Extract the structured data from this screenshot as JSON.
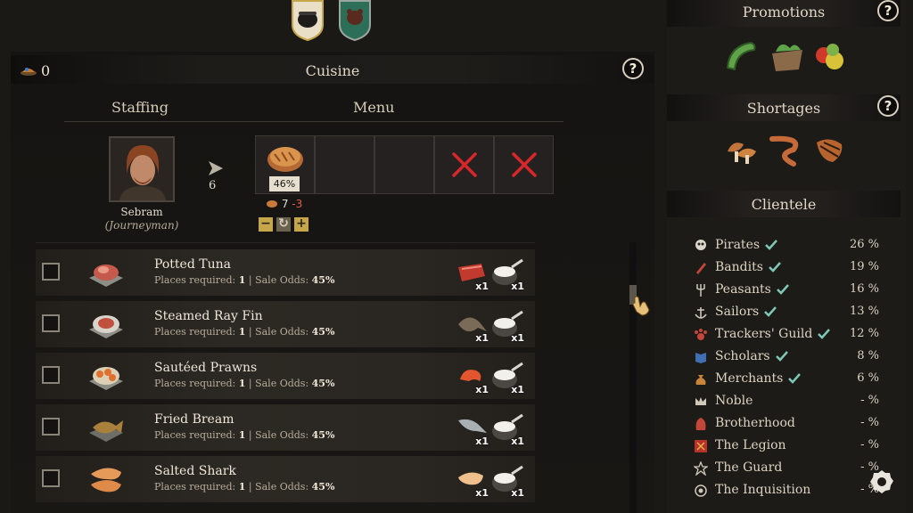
{
  "tabs": [
    {
      "name": "cuisine-tab",
      "icon": "cooking-pot-icon",
      "active": true
    },
    {
      "name": "bear-tab",
      "icon": "bear-banner-icon",
      "active": false
    }
  ],
  "header": {
    "money_icon": "coin-pile-icon",
    "money_value": "0",
    "title": "Cuisine",
    "help": "?"
  },
  "sections": {
    "staffing": "Staffing",
    "menu": "Menu"
  },
  "worker": {
    "name": "Sebram",
    "rank": "(Journeyman)",
    "places": "6"
  },
  "menu_slots": {
    "filled": {
      "dish_icon": "bread-loaf-icon",
      "odds": "46%",
      "stat": "7",
      "stat_delta": "-3"
    },
    "locked_icon": "red-x-icon",
    "controls": {
      "minus": "−",
      "reset": "↻",
      "plus": "+"
    }
  },
  "recipes": [
    {
      "name": "Potted Tuna",
      "places_label": "Places required:",
      "places": "1",
      "odds_label": "Sale Odds:",
      "odds": "45%",
      "ingredients": [
        {
          "icon": "tuna-fillet-icon",
          "qty": "x1"
        },
        {
          "icon": "salt-bowl-icon",
          "qty": "x1"
        }
      ]
    },
    {
      "name": "Steamed Ray Fin",
      "places_label": "Places required:",
      "places": "1",
      "odds_label": "Sale Odds:",
      "odds": "45%",
      "ingredients": [
        {
          "icon": "ray-fish-icon",
          "qty": "x1"
        },
        {
          "icon": "salt-bowl-icon",
          "qty": "x1"
        }
      ]
    },
    {
      "name": "Sautéed Prawns",
      "places_label": "Places required:",
      "places": "1",
      "odds_label": "Sale Odds:",
      "odds": "45%",
      "ingredients": [
        {
          "icon": "prawn-icon",
          "qty": "x1"
        },
        {
          "icon": "salt-bowl-icon",
          "qty": "x1"
        }
      ]
    },
    {
      "name": "Fried Bream",
      "places_label": "Places required:",
      "places": "1",
      "odds_label": "Sale Odds:",
      "odds": "45%",
      "ingredients": [
        {
          "icon": "bream-fish-icon",
          "qty": "x1"
        },
        {
          "icon": "salt-bowl-icon",
          "qty": "x1"
        }
      ]
    },
    {
      "name": "Salted Shark",
      "places_label": "Places required:",
      "places": "1",
      "odds_label": "Sale Odds:",
      "odds": "45%",
      "ingredients": [
        {
          "icon": "shark-meat-icon",
          "qty": "x1"
        },
        {
          "icon": "salt-bowl-icon",
          "qty": "x1"
        }
      ]
    }
  ],
  "promotions": {
    "title": "Promotions",
    "help": "?",
    "items": [
      "sea-cucumber-icon",
      "basket-icon",
      "apples-icon"
    ]
  },
  "shortages": {
    "title": "Shortages",
    "help": "?",
    "items": [
      "mushrooms-icon",
      "eel-icon",
      "fish-icon"
    ]
  },
  "clientele": {
    "title": "Clientele",
    "rows": [
      {
        "name": "Pirates",
        "pct": "26 %",
        "check": true,
        "icon": "skull-flag-icon"
      },
      {
        "name": "Bandits",
        "pct": "19 %",
        "check": true,
        "icon": "dagger-icon"
      },
      {
        "name": "Peasants",
        "pct": "16 %",
        "check": true,
        "icon": "pitchfork-icon"
      },
      {
        "name": "Sailors",
        "pct": "13 %",
        "check": true,
        "icon": "anchor-icon"
      },
      {
        "name": "Trackers' Guild",
        "pct": "12 %",
        "check": true,
        "icon": "paw-icon"
      },
      {
        "name": "Scholars",
        "pct": "8 %",
        "check": true,
        "icon": "book-icon"
      },
      {
        "name": "Merchants",
        "pct": "6 %",
        "check": true,
        "icon": "coin-bag-icon"
      },
      {
        "name": "Noble",
        "pct": "- %",
        "check": false,
        "icon": "crown-icon"
      },
      {
        "name": "Brotherhood",
        "pct": "- %",
        "check": false,
        "icon": "hood-icon"
      },
      {
        "name": "The Legion",
        "pct": "- %",
        "check": false,
        "icon": "legion-banner-icon"
      },
      {
        "name": "The Guard",
        "pct": "- %",
        "check": false,
        "icon": "star-badge-icon"
      },
      {
        "name": "The Inquisition",
        "pct": "- %",
        "check": false,
        "icon": "eye-ring-icon"
      }
    ]
  },
  "colors": {
    "gold": "#c5a64a",
    "red_x": "#d8262a",
    "check": "#7fc7b6",
    "negative": "#e35b4c"
  }
}
